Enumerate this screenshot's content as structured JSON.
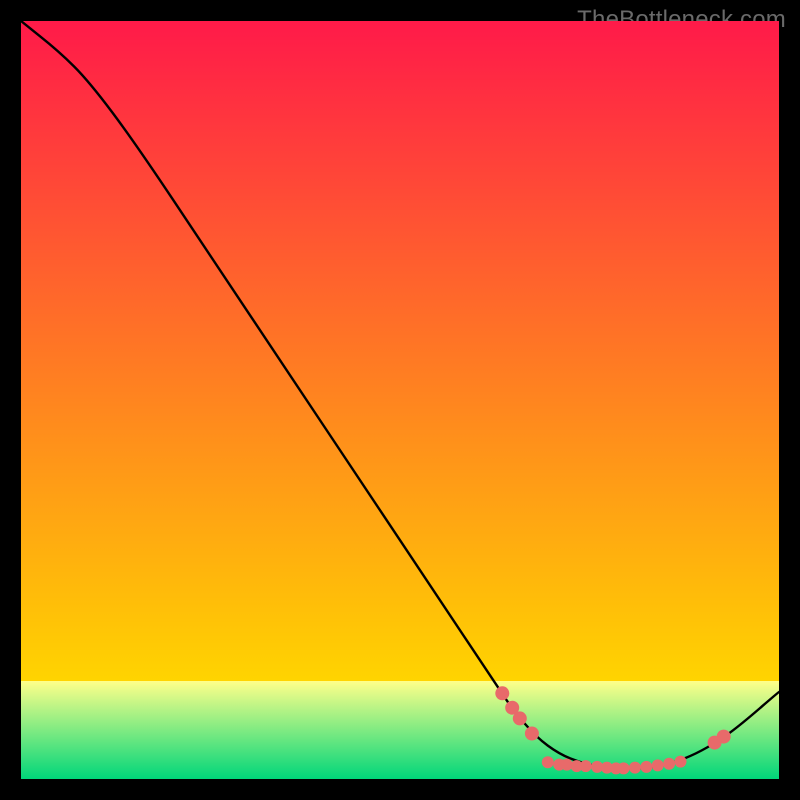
{
  "watermark": "TheBottleneck.com",
  "chart_data": {
    "type": "line",
    "title": "",
    "xlabel": "",
    "ylabel": "",
    "xlim": [
      0,
      100
    ],
    "ylim": [
      0,
      100
    ],
    "grid": false,
    "legend": false,
    "annotations": [],
    "background_gradient": {
      "top": "#ff1a49",
      "mid": "#ffd400",
      "bottom_band_top": "#ffff8a",
      "bottom_band_bottom": "#00d67a"
    },
    "series": [
      {
        "name": "curve",
        "stroke": "#000000",
        "points": [
          {
            "x": 0,
            "y": 100
          },
          {
            "x": 5,
            "y": 96
          },
          {
            "x": 9,
            "y": 92
          },
          {
            "x": 15,
            "y": 84
          },
          {
            "x": 25,
            "y": 69
          },
          {
            "x": 35,
            "y": 54
          },
          {
            "x": 45,
            "y": 39
          },
          {
            "x": 55,
            "y": 24
          },
          {
            "x": 63,
            "y": 12
          },
          {
            "x": 65,
            "y": 9
          },
          {
            "x": 68,
            "y": 5.5
          },
          {
            "x": 71,
            "y": 3.3
          },
          {
            "x": 74,
            "y": 2.1
          },
          {
            "x": 77,
            "y": 1.5
          },
          {
            "x": 80,
            "y": 1.3
          },
          {
            "x": 83,
            "y": 1.5
          },
          {
            "x": 86,
            "y": 2.1
          },
          {
            "x": 89,
            "y": 3.3
          },
          {
            "x": 92,
            "y": 5.0
          },
          {
            "x": 95,
            "y": 7.2
          },
          {
            "x": 100,
            "y": 11.5
          }
        ]
      }
    ],
    "markers": [
      {
        "name": "descent-markers",
        "color": "#e86a6a",
        "r": 7,
        "points": [
          {
            "x": 63.5,
            "y": 11.3
          },
          {
            "x": 64.8,
            "y": 9.4
          },
          {
            "x": 65.8,
            "y": 8.0
          },
          {
            "x": 67.4,
            "y": 6.0
          }
        ]
      },
      {
        "name": "trough-markers",
        "color": "#e86a6a",
        "r": 6,
        "points": [
          {
            "x": 69.5,
            "y": 2.2
          },
          {
            "x": 71.0,
            "y": 1.9
          },
          {
            "x": 72.0,
            "y": 1.9
          },
          {
            "x": 73.3,
            "y": 1.7
          },
          {
            "x": 74.5,
            "y": 1.7
          },
          {
            "x": 76.0,
            "y": 1.6
          },
          {
            "x": 77.3,
            "y": 1.5
          },
          {
            "x": 78.5,
            "y": 1.4
          },
          {
            "x": 79.5,
            "y": 1.4
          },
          {
            "x": 81.0,
            "y": 1.5
          },
          {
            "x": 82.5,
            "y": 1.6
          },
          {
            "x": 84.0,
            "y": 1.8
          },
          {
            "x": 85.5,
            "y": 2.0
          },
          {
            "x": 87.0,
            "y": 2.3
          }
        ]
      },
      {
        "name": "ascent-markers",
        "color": "#e86a6a",
        "r": 7,
        "points": [
          {
            "x": 91.5,
            "y": 4.8
          },
          {
            "x": 92.7,
            "y": 5.6
          }
        ]
      }
    ]
  }
}
